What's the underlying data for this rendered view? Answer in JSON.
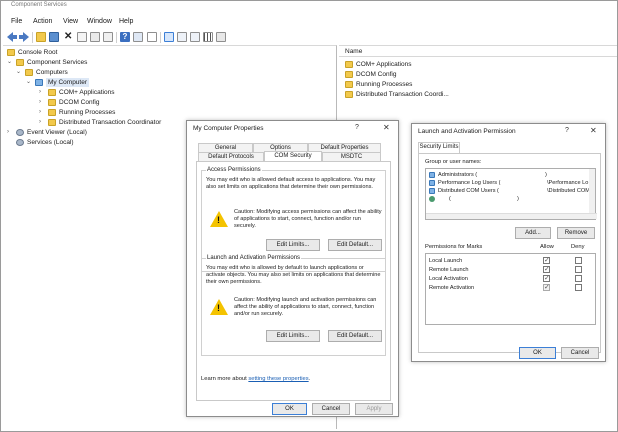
{
  "window": {
    "title": "Component Services"
  },
  "menu": [
    "File",
    "Action",
    "View",
    "Window",
    "Help"
  ],
  "tree": {
    "root": "Console Root",
    "component_services": "Component Services",
    "computers": "Computers",
    "my_computer": "My Computer",
    "children": [
      "COM+ Applications",
      "DCOM Config",
      "Running Processes",
      "Distributed Transaction Coordinator"
    ],
    "event_viewer": "Event Viewer (Local)",
    "services": "Services (Local)"
  },
  "list": {
    "header": "Name",
    "items": [
      "COM+ Applications",
      "DCOM Config",
      "Running Processes",
      "Distributed Transaction Coordi..."
    ]
  },
  "props_dialog": {
    "title": "My Computer Properties",
    "help": "?",
    "close": "✕",
    "tabs_row1": [
      "General",
      "Options",
      "Default Properties"
    ],
    "tabs_row2": [
      "Default Protocols",
      "COM Security",
      "MSDTC"
    ],
    "access": {
      "title": "Access Permissions",
      "desc": "You may edit who is allowed default access to applications. You may also set limits on applications that determine their own permissions.",
      "caution": "Caution: Modifying access permissions can affect the ability of applications to start, connect, function and/or run securely.",
      "edit_limits": "Edit Limits...",
      "edit_default": "Edit Default..."
    },
    "launch": {
      "title": "Launch and Activation Permissions",
      "desc": "You may edit who is allowed by default to launch applications or activate objects. You may also set limits on applications that determine their own permissions.",
      "caution": "Caution: Modifying launch and activation permissions can affect the ability of applications to start, connect, function and/or run securely.",
      "edit_limits": "Edit Limits...",
      "edit_default": "Edit Default..."
    },
    "learn_prefix": "Learn more about ",
    "learn_link": "setting these properties",
    "learn_suffix": ".",
    "ok": "OK",
    "cancel": "Cancel",
    "apply": "Apply"
  },
  "perm_dialog": {
    "title": "Launch and Activation Permission",
    "help": "?",
    "close": "✕",
    "tab": "Security Limits",
    "group_label": "Group or user names:",
    "users": [
      {
        "name": "Administrators (",
        "suffix": ")"
      },
      {
        "name": "Performance Log Users (",
        "suffix": "\\Performance Lo"
      },
      {
        "name": "Distributed COM Users (",
        "suffix": "\\Distributed COM"
      },
      {
        "name": "(",
        "suffix": ")"
      }
    ],
    "add": "Add...",
    "remove": "Remove",
    "perm_label": "Permissions for Marks",
    "allow": "Allow",
    "deny": "Deny",
    "permissions": [
      {
        "name": "Local Launch",
        "allow": "checked",
        "deny": ""
      },
      {
        "name": "Remote Launch",
        "allow": "checked",
        "deny": ""
      },
      {
        "name": "Local Activation",
        "allow": "checked",
        "deny": ""
      },
      {
        "name": "Remote Activation",
        "allow": "checked-dim",
        "deny": ""
      }
    ],
    "ok": "OK",
    "cancel": "Cancel"
  },
  "colors": {
    "folder": "#f2c94c",
    "warning": "#f4c300",
    "link": "#1a5fb4",
    "accent": "#3c7fd6"
  }
}
